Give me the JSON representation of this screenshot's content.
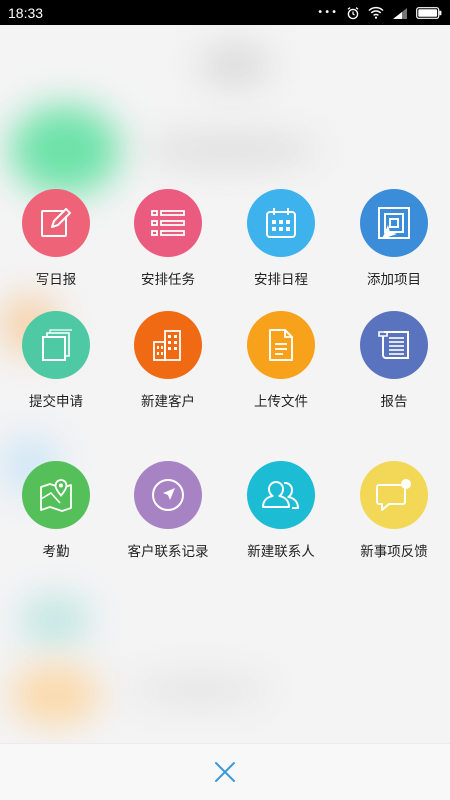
{
  "status_bar": {
    "time": "18:33",
    "dots": "•••"
  },
  "actions": [
    {
      "label": "写日报",
      "color": "#ee6377",
      "icon": "edit-icon"
    },
    {
      "label": "安排任务",
      "color": "#eb5b80",
      "icon": "list-icon"
    },
    {
      "label": "安排日程",
      "color": "#3db2ed",
      "icon": "calendar-icon"
    },
    {
      "label": "添加项目",
      "color": "#3b8cd9",
      "icon": "project-icon"
    },
    {
      "label": "提交申请",
      "color": "#4fc8a4",
      "icon": "copy-icon"
    },
    {
      "label": "新建客户",
      "color": "#f06a13",
      "icon": "building-icon"
    },
    {
      "label": "上传文件",
      "color": "#f7a21a",
      "icon": "document-icon"
    },
    {
      "label": "报告",
      "color": "#5a73bf",
      "icon": "report-icon"
    },
    {
      "label": "考勤",
      "color": "#55c05a",
      "icon": "map-pin-icon"
    },
    {
      "label": "客户联系记录",
      "color": "#a883c4",
      "icon": "compass-icon"
    },
    {
      "label": "新建联系人",
      "color": "#1bbcd4",
      "icon": "contacts-icon"
    },
    {
      "label": "新事项反馈",
      "color": "#f3d857",
      "icon": "chat-icon"
    }
  ],
  "close_icon": "close-icon",
  "colors": {
    "close": "#3a9ad9",
    "background": "#f4f4f5"
  }
}
